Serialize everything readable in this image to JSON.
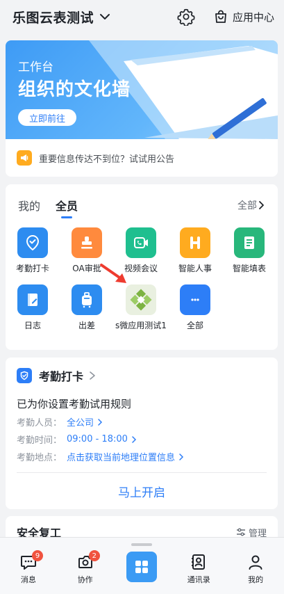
{
  "header": {
    "org_title": "乐图云表测试",
    "app_center_label": "应用中心"
  },
  "banner": {
    "subtitle": "工作台",
    "title": "组织的文化墙",
    "button_label": "立即前往"
  },
  "notice": {
    "text": "重要信息传达不到位？试试用公告"
  },
  "apps": {
    "tabs": [
      {
        "label": "我的",
        "active": false
      },
      {
        "label": "全员",
        "active": true
      }
    ],
    "all_label": "全部",
    "items": [
      {
        "label": "考勤打卡",
        "icon": "attendance-icon",
        "color": "#2d8cf0"
      },
      {
        "label": "OA审批",
        "icon": "stamp-icon",
        "color": "#ff8a3d"
      },
      {
        "label": "视频会议",
        "icon": "video-call-icon",
        "color": "#1fbf8f"
      },
      {
        "label": "智能人事",
        "icon": "h-letter-icon",
        "color": "#ffab1f"
      },
      {
        "label": "智能填表",
        "icon": "form-icon",
        "color": "#28b77b"
      },
      {
        "label": "日志",
        "icon": "log-icon",
        "color": "#2d8cf0"
      },
      {
        "label": "出差",
        "icon": "luggage-icon",
        "color": "#2d8cf0"
      },
      {
        "label": "s微应用测试1",
        "icon": "grid-diamond-icon",
        "color": "#8bc34a"
      },
      {
        "label": "全部",
        "icon": "more-dots-icon",
        "color": "#2d7ef7"
      }
    ]
  },
  "attendance": {
    "title": "考勤打卡",
    "message": "已为你设置考勤试用规则",
    "rows": [
      {
        "key": "考勤人员：",
        "value": "全公司"
      },
      {
        "key": "考勤时间：",
        "value": "09:00 - 18:00"
      },
      {
        "key": "考勤地点：",
        "value": "点击获取当前地理位置信息"
      }
    ],
    "start_button": "马上开启"
  },
  "safety": {
    "title": "安全复工",
    "manage_label": "管理"
  },
  "tabbar": {
    "items": [
      {
        "label": "消息",
        "badge": "9"
      },
      {
        "label": "协作",
        "badge": "2"
      },
      {
        "label": "",
        "badge": ""
      },
      {
        "label": "通讯录",
        "badge": ""
      },
      {
        "label": "我的",
        "badge": ""
      }
    ]
  },
  "colors": {
    "accent": "#2d7ef7",
    "badge": "#f0533f",
    "home": "#3b9bf4"
  }
}
